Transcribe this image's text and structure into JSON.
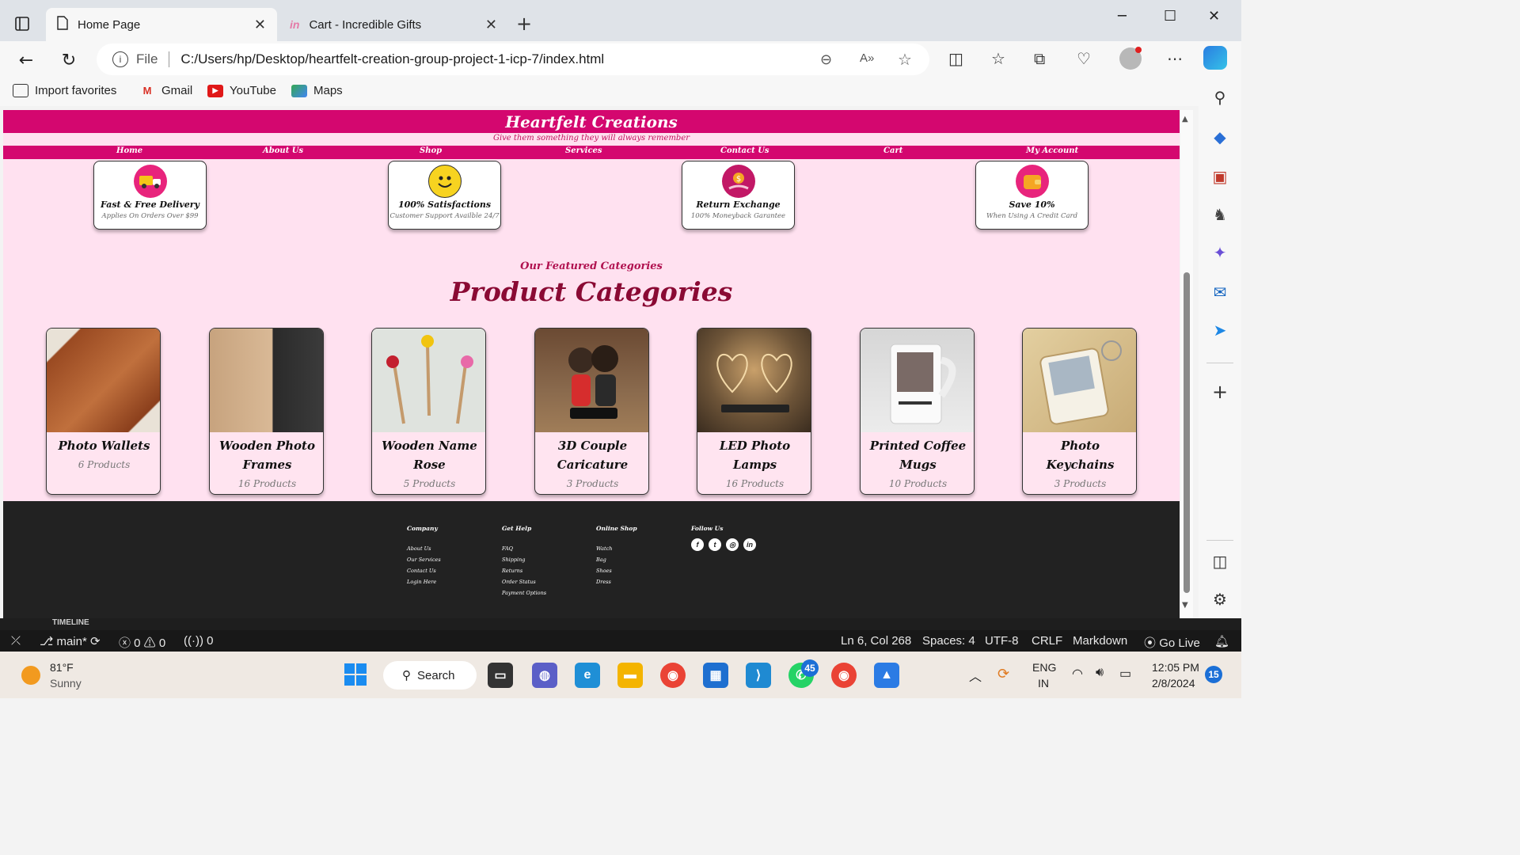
{
  "browser": {
    "tabs": [
      {
        "title": "Home Page",
        "active": true
      },
      {
        "title": "Cart - Incredible Gifts",
        "active": false
      }
    ],
    "address": {
      "scheme_label": "File",
      "url": "C:/Users/hp/Desktop/heartfelt-creation-group-project-1-icp-7/index.html"
    },
    "favorites": [
      {
        "label": "Import favorites",
        "icon": "import-icon"
      },
      {
        "label": "Gmail",
        "icon": "gmail-icon"
      },
      {
        "label": "YouTube",
        "icon": "youtube-icon"
      },
      {
        "label": "Maps",
        "icon": "maps-icon"
      }
    ]
  },
  "site": {
    "title": "Heartfelt Creations",
    "tagline": "Give them something they will always remember",
    "nav": [
      "Home",
      "About Us",
      "Shop",
      "Services",
      "Contact Us",
      "Cart",
      "My Account"
    ],
    "features": [
      {
        "title": "Fast & Free Delivery",
        "subtitle": "Applies On Orders Over $99",
        "icon": "delivery-truck-icon"
      },
      {
        "title": "100% Satisfactions",
        "subtitle": "Customer Support Availble 24/7",
        "icon": "smiley-icon"
      },
      {
        "title": "Return Exchange",
        "subtitle": "100% Moneyback Garantee",
        "icon": "money-hand-icon"
      },
      {
        "title": "Save 10%",
        "subtitle": "When Using A Credit Card",
        "icon": "wallet-icon"
      }
    ],
    "categories_subtitle": "Our Featured Categories",
    "categories_title": "Product Categories",
    "categories": [
      {
        "name": "Photo Wallets",
        "count": "6 Products"
      },
      {
        "name": "Wooden Photo Frames",
        "count": "16 Products"
      },
      {
        "name": "Wooden Name Rose",
        "count": "5 Products"
      },
      {
        "name": "3D Couple Caricature",
        "count": "3 Products"
      },
      {
        "name": "LED Photo Lamps",
        "count": "16 Products"
      },
      {
        "name": "Printed Coffee Mugs",
        "count": "10 Products"
      },
      {
        "name": "Photo Keychains",
        "count": "3 Products"
      }
    ],
    "footer": {
      "columns": [
        {
          "heading": "Company",
          "links": [
            "About Us",
            "Our Services",
            "Contact Us",
            "Login Here"
          ]
        },
        {
          "heading": "Get Help",
          "links": [
            "FAQ",
            "Shipping",
            "Returns",
            "Order Status",
            "Payment Options"
          ]
        },
        {
          "heading": "Online Shop",
          "links": [
            "Watch",
            "Bag",
            "Shoes",
            "Dress"
          ]
        }
      ],
      "follow_heading": "Follow Us",
      "social": [
        {
          "icon": "facebook-icon",
          "glyph": "f"
        },
        {
          "icon": "twitter-icon",
          "glyph": "t"
        },
        {
          "icon": "instagram-icon",
          "glyph": "◎"
        },
        {
          "icon": "linkedin-icon",
          "glyph": "in"
        }
      ]
    }
  },
  "vscode": {
    "panel_label": "TIMELINE",
    "branch": "main*",
    "errors": "0",
    "warnings": "0",
    "ports": "0",
    "cursor": "Ln 6, Col 268",
    "spaces": "Spaces: 4",
    "encoding": "UTF-8",
    "eol": "CRLF",
    "language": "Markdown",
    "golive": "Go Live"
  },
  "taskbar": {
    "temperature": "81°F",
    "condition": "Sunny",
    "search_label": "Search",
    "whatsapp_badge": "45",
    "language": "ENG",
    "region": "IN",
    "time": "12:05 PM",
    "date": "2/8/2024",
    "notifications": "15"
  },
  "colors": {
    "brand_pink": "#d4076f",
    "page_bg": "#ffe1f0",
    "heading_maroon": "#8a0a34",
    "footer_bg": "#222222"
  }
}
